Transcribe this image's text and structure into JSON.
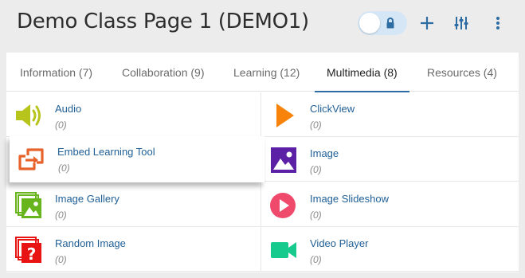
{
  "header": {
    "title": "Demo Class Page 1 (DEMO1)"
  },
  "tabs": [
    {
      "label": "Information (7)"
    },
    {
      "label": "Collaboration (9)"
    },
    {
      "label": "Learning (12)"
    },
    {
      "label": "Multimedia (8)"
    },
    {
      "label": "Resources (4)"
    }
  ],
  "active_tab": "Multimedia (8)",
  "tools": [
    {
      "name": "Audio",
      "count": "(0)",
      "icon": "speaker-icon",
      "color": "#b7c41c"
    },
    {
      "name": "ClickView",
      "count": "(0)",
      "icon": "play-triangle-icon",
      "color": "#f7830a"
    },
    {
      "name": "Embed Learning Tool",
      "count": "(0)",
      "icon": "embed-arrows-icon",
      "color": "#e8632b"
    },
    {
      "name": "Image",
      "count": "(0)",
      "icon": "image-icon",
      "color": "#5b20a6"
    },
    {
      "name": "Image Gallery",
      "count": "(0)",
      "icon": "image-gallery-icon",
      "color": "#68b41c"
    },
    {
      "name": "Image Slideshow",
      "count": "(0)",
      "icon": "slideshow-play-icon",
      "color": "#ef4a6c"
    },
    {
      "name": "Random Image",
      "count": "(0)",
      "icon": "random-image-icon",
      "color": "#e81313"
    },
    {
      "name": "Video Player",
      "count": "(0)",
      "icon": "video-camera-icon",
      "color": "#16c98c"
    }
  ],
  "colors": {
    "accent": "#2e6da4",
    "toggle_bg": "#d5e7f6",
    "link": "#1f5f96"
  }
}
